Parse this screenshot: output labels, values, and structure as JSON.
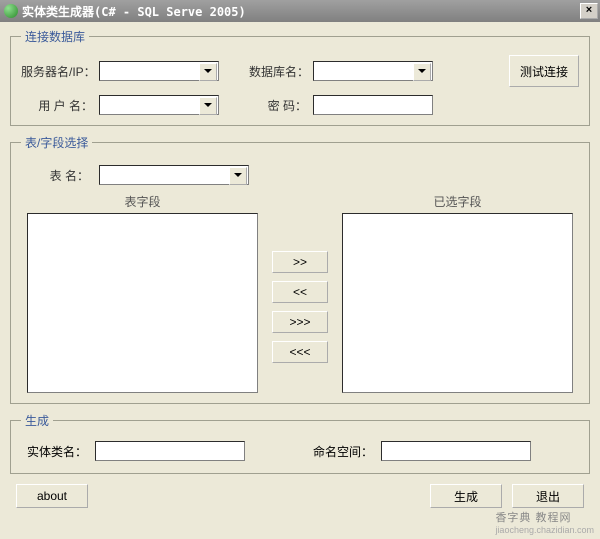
{
  "title": "实体类生成器(C# - SQL Serve 2005)",
  "close_symbol": "×",
  "conn": {
    "legend": "连接数据库",
    "server_label": "服务器名/IP：",
    "server_value": "",
    "db_label": "数据库名：",
    "db_value": "",
    "user_label": "用 户 名：",
    "user_value": "",
    "pwd_label": "密  码：",
    "pwd_value": "",
    "test_btn": "测试连接"
  },
  "table": {
    "legend": "表/字段选择",
    "table_label": "表   名：",
    "table_value": "",
    "left_header": "表字段",
    "right_header": "已选字段",
    "move_one_right": ">>",
    "move_one_left": "<<",
    "move_all_right": ">>>",
    "move_all_left": "<<<"
  },
  "gen": {
    "legend": "生成",
    "class_label": "实体类名：",
    "class_value": "",
    "ns_label": "命名空间：",
    "ns_value": ""
  },
  "footer": {
    "about": "about",
    "generate": "生成",
    "exit": "退出"
  },
  "watermark": {
    "main": "香字典 教程网",
    "sub": "jiaocheng.chazidian.com"
  }
}
